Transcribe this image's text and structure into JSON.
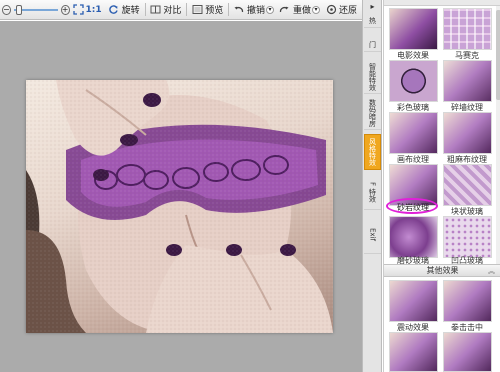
{
  "toolbar": {
    "zoom_minus_icon": "minus-icon",
    "zoom_plus_icon": "plus-icon",
    "zoom_level": 0.05,
    "actual_size": "1:1",
    "rotate": "旋转",
    "compare": "对比",
    "preview": "预览",
    "undo": "撤销",
    "redo": "重做",
    "restore": "还原"
  },
  "side_tabs": {
    "t1": "热",
    "t2": "门",
    "t3": "智能特效",
    "t4": "数码暗房",
    "t5": "风格特效",
    "t6": "F 特效",
    "t7": "Exif"
  },
  "effects": {
    "e1": "电影效果",
    "e2": "马赛克",
    "e3": "彩色玻璃",
    "e4": "碎墙纹理",
    "e5": "画布纹理",
    "e6": "粗麻布纹理",
    "e7": "砂岩纹理",
    "e8": "块状玻璃",
    "e9": "磨砂玻璃",
    "e10": "凹凸玻璃"
  },
  "other_section": {
    "title": "其他效果",
    "o1": "震动效果",
    "o2": "拳击击中"
  },
  "selected_effect": "砂岩纹理",
  "colors": {
    "active_tab": "#f0a71f",
    "highlight": "#e020d8",
    "canvas_bg": "#ababab"
  }
}
